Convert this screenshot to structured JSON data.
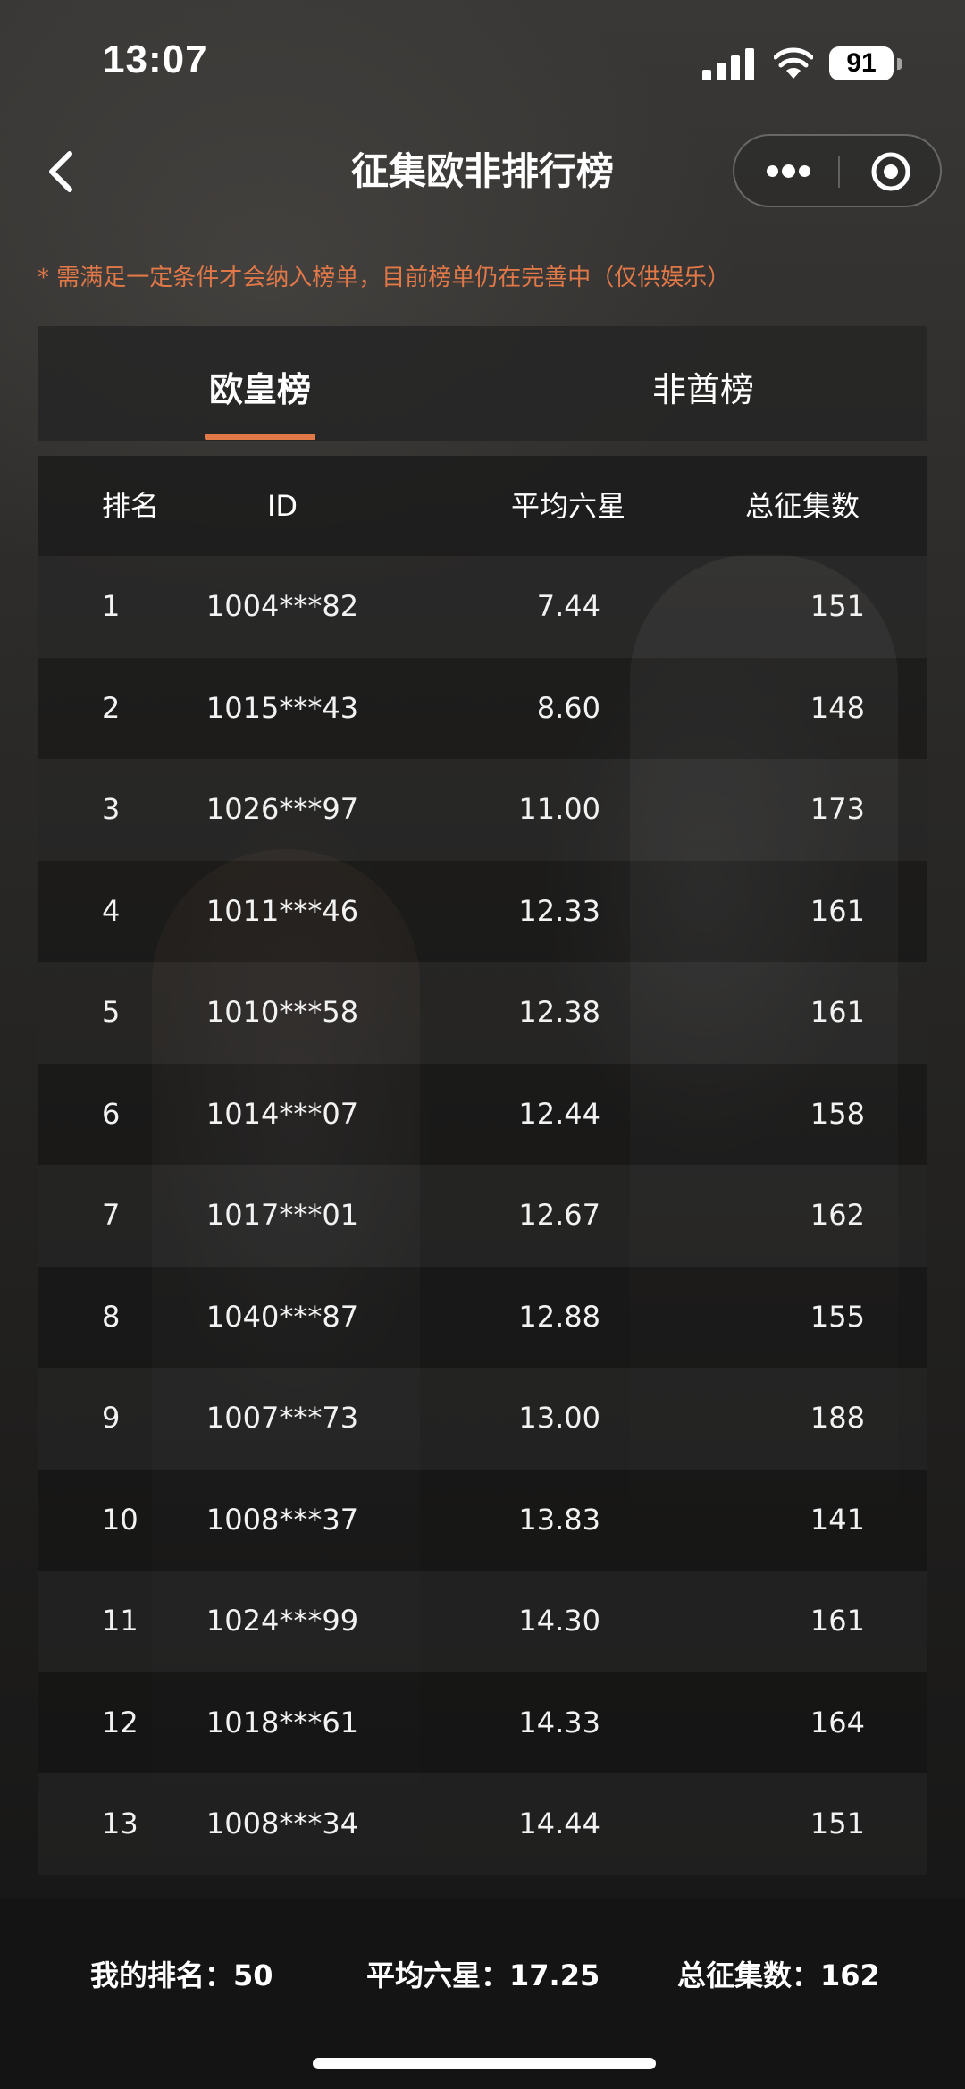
{
  "status_bar": {
    "time": "13:07",
    "battery": "91",
    "icons": [
      "signal-icon",
      "wifi-icon",
      "battery-icon"
    ]
  },
  "nav": {
    "title": "征集欧非排行榜",
    "back_icon": "chevron-left-icon",
    "capsule_icons": [
      "more-icon",
      "close-miniprogram-icon"
    ]
  },
  "notice": "* 需满足一定条件才会纳入榜单，目前榜单仍在完善中（仅供娱乐）",
  "tabs": [
    {
      "label": "欧皇榜",
      "active": true
    },
    {
      "label": "非酋榜",
      "active": false
    }
  ],
  "table": {
    "headers": {
      "rank": "排名",
      "id": "ID",
      "avg": "平均六星",
      "total": "总征集数"
    },
    "rows": [
      {
        "rank": "1",
        "id": "1004***82",
        "avg": "7.44",
        "total": "151"
      },
      {
        "rank": "2",
        "id": "1015***43",
        "avg": "8.60",
        "total": "148"
      },
      {
        "rank": "3",
        "id": "1026***97",
        "avg": "11.00",
        "total": "173"
      },
      {
        "rank": "4",
        "id": "1011***46",
        "avg": "12.33",
        "total": "161"
      },
      {
        "rank": "5",
        "id": "1010***58",
        "avg": "12.38",
        "total": "161"
      },
      {
        "rank": "6",
        "id": "1014***07",
        "avg": "12.44",
        "total": "158"
      },
      {
        "rank": "7",
        "id": "1017***01",
        "avg": "12.67",
        "total": "162"
      },
      {
        "rank": "8",
        "id": "1040***87",
        "avg": "12.88",
        "total": "155"
      },
      {
        "rank": "9",
        "id": "1007***73",
        "avg": "13.00",
        "total": "188"
      },
      {
        "rank": "10",
        "id": "1008***37",
        "avg": "13.83",
        "total": "141"
      },
      {
        "rank": "11",
        "id": "1024***99",
        "avg": "14.30",
        "total": "161"
      },
      {
        "rank": "12",
        "id": "1018***61",
        "avg": "14.33",
        "total": "164"
      },
      {
        "rank": "13",
        "id": "1008***34",
        "avg": "14.44",
        "total": "151"
      }
    ]
  },
  "summary": {
    "my_rank_label": "我的排名：",
    "my_rank": "50",
    "avg_label": "平均六星：",
    "avg": "17.25",
    "total_label": "总征集数：",
    "total": "162"
  },
  "colors": {
    "accent": "#e07848",
    "background": "#1c1c1c"
  }
}
